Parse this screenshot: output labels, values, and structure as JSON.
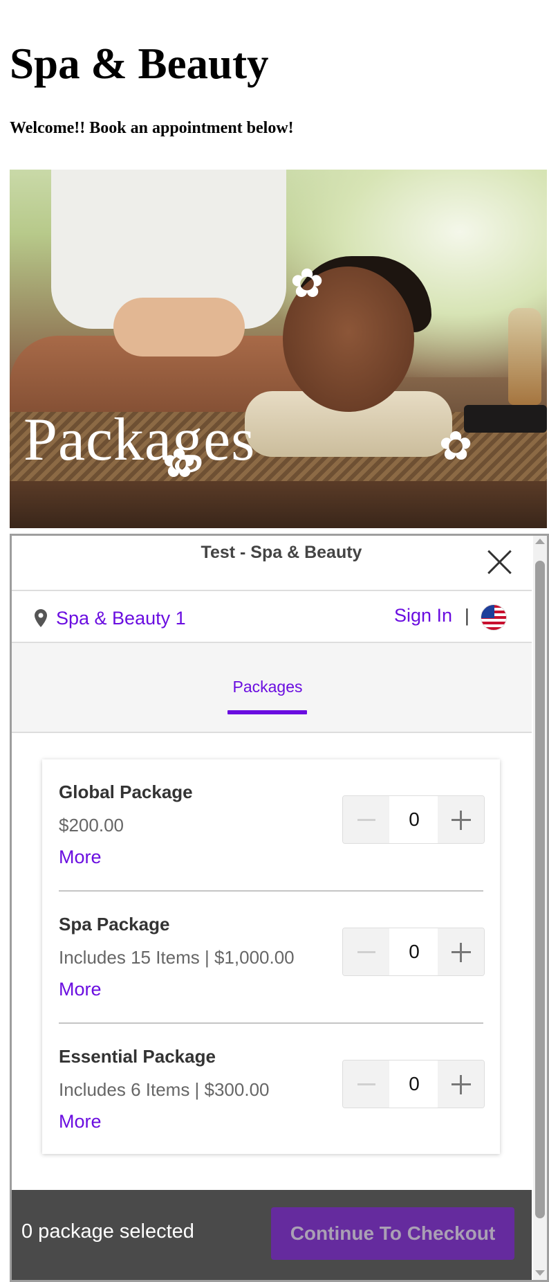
{
  "page": {
    "title": "Spa & Beauty",
    "welcome": "Welcome!! Book an appointment below!",
    "hero_label": "Packages"
  },
  "widget": {
    "title": "Test - Spa & Beauty",
    "location": "Spa & Beauty 1",
    "sign_in": "Sign In",
    "separator": "|",
    "tabs": [
      {
        "label": "Packages",
        "active": true
      }
    ],
    "packages": [
      {
        "name": "Global Package",
        "description": "$200.00",
        "more": "More",
        "quantity": "0"
      },
      {
        "name": "Spa Package",
        "description": "Includes 15 Items | $1,000.00",
        "more": "More",
        "quantity": "0"
      },
      {
        "name": "Essential Package",
        "description": "Includes 6 Items | $300.00",
        "more": "More",
        "quantity": "0"
      }
    ],
    "footer": {
      "selected_text": "0 package selected",
      "checkout_label": "Continue To Checkout"
    }
  },
  "colors": {
    "accent": "#6a0de0",
    "footer_bg": "#4a4a4a",
    "checkout_bg": "#652b9e"
  },
  "icons": [
    "map-pin-icon",
    "us-flag-icon",
    "close-icon",
    "minus-icon",
    "plus-icon"
  ]
}
